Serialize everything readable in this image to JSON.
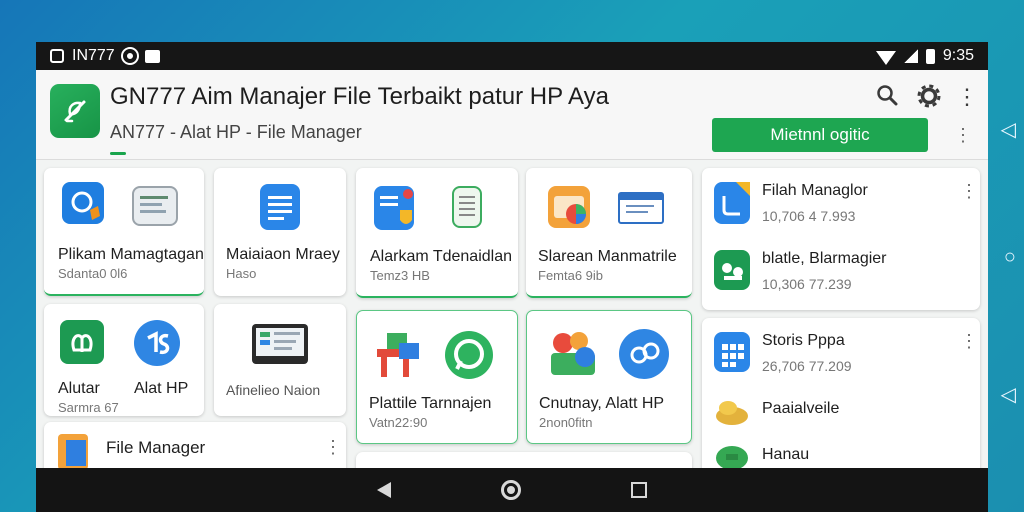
{
  "status_bar": {
    "carrier_text": "IN777",
    "time": "9:35"
  },
  "header": {
    "title": "GN777 Aim Manajer File Terbaikt patur HP Ayа",
    "subtitle": "AN777 - Alat HP - File Manager",
    "primary_button_label": "Mietnnl ogitic",
    "icons": [
      "search-icon",
      "gear-icon",
      "more-vert-icon"
    ]
  },
  "cards": [
    {
      "title": "Plikam Mamagtagan",
      "subtitle": "Sdanta0 0l6"
    },
    {
      "title": "Maiaiaon Mraey",
      "subtitle": "Haso"
    },
    {
      "title": "Alarkam Tdenaidlan",
      "subtitle": "Temz3 HB"
    },
    {
      "title": "Slarean Manmatrile",
      "subtitle": "Femta6 9ib"
    },
    {
      "title": "Alutar",
      "subtitle": "Sarmra 67"
    },
    {
      "title": "Alat HP",
      "subtitle": ""
    },
    {
      "title": "Afinelieo Naion",
      "subtitle": ""
    },
    {
      "title": "Plattile Tarnnajen",
      "subtitle": "Vatn22:90"
    },
    {
      "title": "Cnutnay, Alatt HP",
      "subtitle": "2non0fitn"
    },
    {
      "title": "File Manager",
      "subtitle": ""
    }
  ],
  "side_list": [
    {
      "title": "Filah Managlor",
      "subtitle": "10,706 4 7.993"
    },
    {
      "title": "blatle, Blarmagier",
      "subtitle": "10,306 77.239"
    },
    {
      "title": "Storis Pppa",
      "subtitle": "26,706 77.209"
    },
    {
      "title": "Paaialveile",
      "subtitle": ""
    },
    {
      "title": "Hanau",
      "subtitle": ""
    }
  ],
  "colors": {
    "accent": "#1ea651",
    "status_bar": "#161616",
    "nav_bar": "#141414"
  }
}
